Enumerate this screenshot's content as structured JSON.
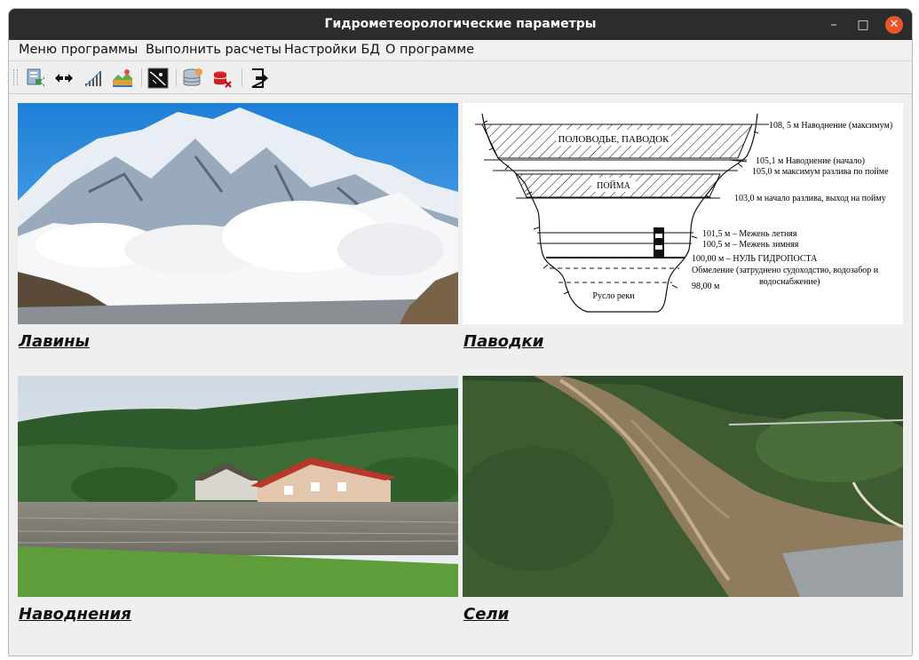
{
  "window": {
    "title": "Гидрометеорологические параметры",
    "controls": {
      "minimize": "–",
      "maximize": "□",
      "close": "✕"
    }
  },
  "menu": [
    "Меню программы",
    "Выполнить расчеты",
    "Настройки БД",
    "О программе"
  ],
  "toolbar": {
    "icons": [
      "import-data-icon",
      "range-arrows-icon",
      "signal-bars-icon",
      "landscape-chart-icon",
      "snow-curve-icon",
      "database-settings-icon",
      "database-delete-icon",
      "exit-icon"
    ]
  },
  "tiles": [
    {
      "caption": "Лавины"
    },
    {
      "caption": "Паводки"
    },
    {
      "caption": "Наводнения"
    },
    {
      "caption": "Сели"
    }
  ],
  "diagram": {
    "inner_labels": {
      "flood": "ПОЛОВОДЬЕ, ПАВОДОК",
      "floodplain": "ПОЙМА",
      "channel": "Русло реки"
    },
    "levels": [
      "108, 5 м Наводнение (максимум)",
      "105,1 м Наводнение (начало)",
      "105,0 м максимум разлива по пойме",
      "103,0 м начало разлива, выход на пойму",
      "101,5 м – Межень летняя",
      "100,5 м – Межень зимняя",
      "100,00 м – НУЛЬ ГИДРОПОСТА",
      "Обмеление (затруднено судоходство, водозабор и",
      "водоснабжение)",
      "98,00 м"
    ]
  }
}
